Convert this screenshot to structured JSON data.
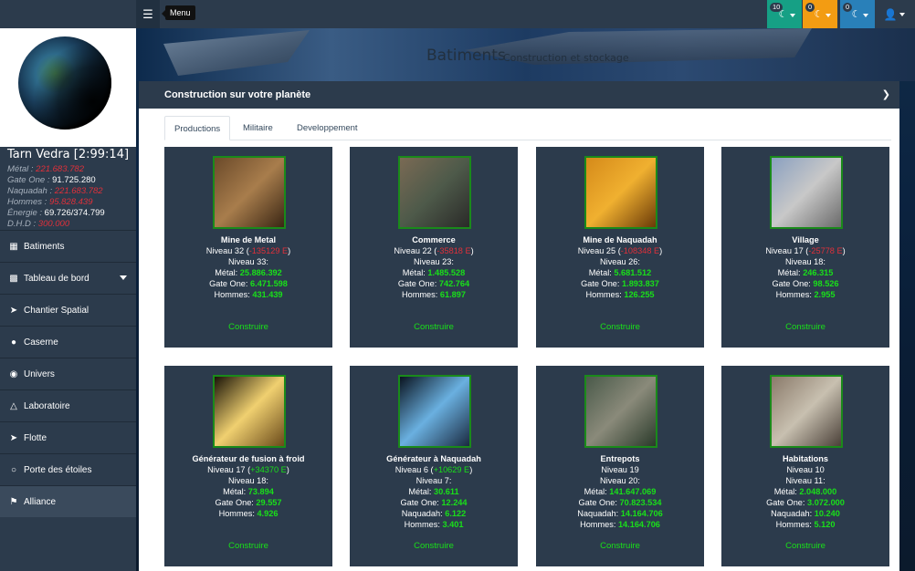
{
  "topbar": {
    "menu_icon": "bars-icon",
    "tooltip": "Menu",
    "notifications": [
      {
        "count": "10",
        "color": "#16a085",
        "icon": "moon-icon"
      },
      {
        "count": "0",
        "color": "#f39c12",
        "icon": "moon-icon"
      },
      {
        "count": "0",
        "color": "#2980b9",
        "icon": "moon-icon"
      }
    ],
    "user_icon": "user-icon"
  },
  "sidebar": {
    "planet_name": "Tarn Vedra [2:99:14]",
    "resources": [
      {
        "label": "Métal :",
        "value": "221.683.782",
        "red": true
      },
      {
        "label": "Gate One :",
        "value": "91.725.280",
        "red": false
      },
      {
        "label": "Naquadah :",
        "value": "221.683.782",
        "red": true
      },
      {
        "label": "Hommes :",
        "value": "95.828.439",
        "red": true
      },
      {
        "label": "Énergie :",
        "value": "69.726/374.799",
        "red": false
      },
      {
        "label": "D.H.D :",
        "value": "300.000",
        "red": true
      }
    ],
    "menu": [
      {
        "label": "Batiments",
        "icon": "building-icon"
      },
      {
        "label": "Tableau de bord",
        "icon": "chart-icon"
      },
      {
        "label": "Chantier Spatial",
        "icon": "spaceship-icon"
      },
      {
        "label": "Caserne",
        "icon": "bomb-icon"
      },
      {
        "label": "Univers",
        "icon": "globe-icon"
      },
      {
        "label": "Laboratoire",
        "icon": "flask-icon"
      },
      {
        "label": "Flotte",
        "icon": "fleet-icon"
      },
      {
        "label": "Porte des étoiles",
        "icon": "circle-icon"
      },
      {
        "label": "Alliance",
        "icon": "flag-icon"
      }
    ]
  },
  "header": {
    "title": "Batiments",
    "subtitle": "Construction et stockage"
  },
  "panel": {
    "title": "Construction sur votre planète",
    "tabs": [
      "Productions",
      "Militaire",
      "Developpement"
    ]
  },
  "buildings": [
    {
      "name": "Mine de Metal",
      "level": "Niveau 32 (",
      "energy": "-135129 E",
      "energy_positive": false,
      "next_level": "Niveau 33:",
      "costs": [
        {
          "label": "Métal:",
          "value": "25.886.392"
        },
        {
          "label": "Gate One:",
          "value": "6.471.598"
        },
        {
          "label": "Hommes:",
          "value": "431.439"
        }
      ],
      "action": "Construire",
      "thumb_colors": [
        "#6b4a2a",
        "#a87d4c",
        "#3a2614"
      ]
    },
    {
      "name": "Commerce",
      "level": "Niveau 22 (",
      "energy": "-35818 E",
      "energy_positive": false,
      "next_level": "Niveau 23:",
      "costs": [
        {
          "label": "Métal:",
          "value": "1.485.528"
        },
        {
          "label": "Gate One:",
          "value": "742.764"
        },
        {
          "label": "Hommes:",
          "value": "61.897"
        }
      ],
      "action": "Construire",
      "thumb_colors": [
        "#7a6a54",
        "#4e5a4a",
        "#2a2a28"
      ]
    },
    {
      "name": "Mine de Naquadah",
      "level": "Niveau 25 (",
      "energy": "-108348 E",
      "energy_positive": false,
      "next_level": "Niveau 26:",
      "costs": [
        {
          "label": "Métal:",
          "value": "5.681.512"
        },
        {
          "label": "Gate One:",
          "value": "1.893.837"
        },
        {
          "label": "Hommes:",
          "value": "126.255"
        }
      ],
      "action": "Construire",
      "thumb_colors": [
        "#d58a1a",
        "#f0b030",
        "#6a3a08"
      ]
    },
    {
      "name": "Village",
      "level": "Niveau 17 (",
      "energy": "-25778 E",
      "energy_positive": false,
      "next_level": "Niveau 18:",
      "costs": [
        {
          "label": "Métal:",
          "value": "246.315"
        },
        {
          "label": "Gate One:",
          "value": "98.526"
        },
        {
          "label": "Hommes:",
          "value": "2.955"
        }
      ],
      "action": "Construire",
      "thumb_colors": [
        "#8aa0c0",
        "#c8c8c8",
        "#6a6a6a"
      ]
    },
    {
      "name": "Générateur de fusion à froid",
      "level": "Niveau 17 (",
      "energy": "+34370 E",
      "energy_positive": true,
      "next_level": "Niveau 18:",
      "costs": [
        {
          "label": "Métal:",
          "value": "73.894"
        },
        {
          "label": "Gate One:",
          "value": "29.557"
        },
        {
          "label": "Hommes:",
          "value": "4.926"
        }
      ],
      "action": "Construire",
      "thumb_colors": [
        "#1a1408",
        "#f0d070",
        "#6a4a1a"
      ]
    },
    {
      "name": "Générateur à Naquadah",
      "level": "Niveau 6 (",
      "energy": "+10629 E",
      "energy_positive": true,
      "next_level": "Niveau 7:",
      "costs": [
        {
          "label": "Métal:",
          "value": "30.611"
        },
        {
          "label": "Gate One:",
          "value": "12.244"
        },
        {
          "label": "Naquadah:",
          "value": "6.122"
        },
        {
          "label": "Hommes:",
          "value": "3.401"
        }
      ],
      "action": "Construire",
      "thumb_colors": [
        "#0a1420",
        "#6ab0e0",
        "#1a2a40"
      ]
    },
    {
      "name": "Entrepots",
      "level": "Niveau 19",
      "energy": "",
      "energy_positive": true,
      "next_level": "Niveau 20:",
      "costs": [
        {
          "label": "Métal:",
          "value": "141.647.069"
        },
        {
          "label": "Gate One:",
          "value": "70.823.534"
        },
        {
          "label": "Naquadah:",
          "value": "14.164.706"
        },
        {
          "label": "Hommes:",
          "value": "14.164.706"
        }
      ],
      "action": "Construire",
      "thumb_colors": [
        "#4a5a4a",
        "#8a8a7a",
        "#2a3a2a"
      ]
    },
    {
      "name": "Habitations",
      "level": "Niveau 10",
      "energy": "",
      "energy_positive": true,
      "next_level": "Niveau 11:",
      "costs": [
        {
          "label": "Métal:",
          "value": "2.048.000"
        },
        {
          "label": "Gate One:",
          "value": "3.072.000"
        },
        {
          "label": "Naquadah:",
          "value": "10.240"
        },
        {
          "label": "Hommes:",
          "value": "5.120"
        }
      ],
      "action": "Construire",
      "thumb_colors": [
        "#8a7a6a",
        "#c8c0b0",
        "#4a4038"
      ]
    }
  ]
}
